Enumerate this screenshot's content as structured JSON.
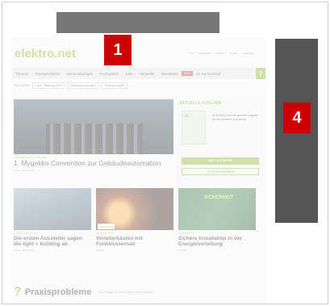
{
  "site": {
    "logo": "elektro.net",
    "utility_links": [
      "Abo",
      "Mediadaten",
      "Karriere",
      "Kontakt",
      "Newsletter"
    ],
    "nav_items": [
      "Themen",
      "Praxisprobleme",
      "Veranstaltungen",
      "Fachwissen",
      "Jobs",
      "Hersteller",
      "Newsletter",
      "NEW",
      "de-Kurzportrait"
    ],
    "topics_label": "Top-Themen",
    "topics": [
      "Light + Building 2026",
      "Gebäudeautomation",
      "Elektromobilität"
    ]
  },
  "hero": {
    "kicker": "GEBÄUDEAUTOMATION",
    "title": "1. Mygekko Convention zur Gebäudeautomation",
    "meta": "Event · 16.03.2026"
  },
  "aside": {
    "heading": "AKTUELLE AUSGABE",
    "cover_tag": "de",
    "issue_text": "de 6/2026 Jetzt die aktuelle Ausgabe der de bestellen und lesen!",
    "primary_button": "HEFT & E-PAPER",
    "secondary_button": "JETZT ABONNIEREN"
  },
  "cards": [
    {
      "kicker": "LIGHT + BUILDING",
      "title": "Die ersten Aussteller sagen die light + building ab",
      "meta": "Event · 16.03.2026"
    },
    {
      "kicker": "SPELSBERG",
      "title": "Verteilerkästen mit Funktionserhalt",
      "meta": "Produkt",
      "brand": "spelsberg"
    },
    {
      "kicker": "SCHNEIDER",
      "title": "Sichere Installation in der Energieverteilung",
      "meta": "Produkt",
      "brand": "SICHERHEIT"
    }
  ],
  "praxis": {
    "icon_text": "?",
    "title": "Praxisprobleme",
    "subtitle": "Ihre Fragen an unsere Branchen-Experten"
  },
  "markers": {
    "badge_1": "1",
    "badge_4": "4"
  },
  "colors": {
    "brand_green": "#8ab82a",
    "marker_red": "#cc0000",
    "placeholder_gray": "#777777"
  }
}
